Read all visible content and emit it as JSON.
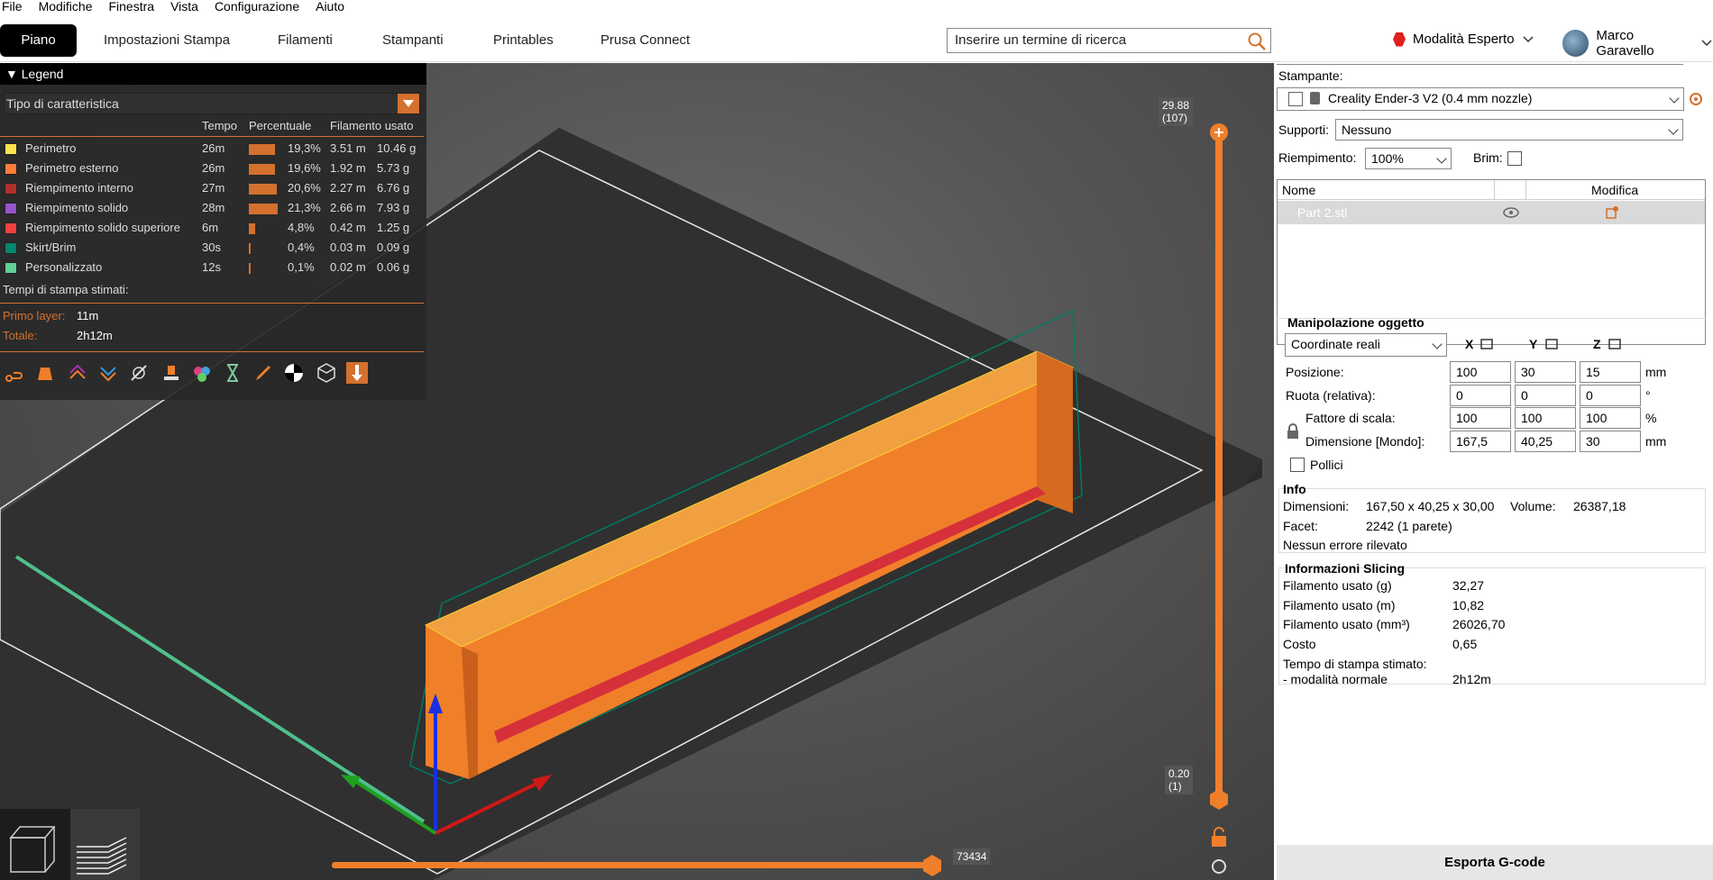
{
  "menu": [
    "File",
    "Modifiche",
    "Finestra",
    "Vista",
    "Configurazione",
    "Aiuto"
  ],
  "tabs": [
    "Piano",
    "Impostazioni Stampa",
    "Filamenti",
    "Stampanti",
    "Printables",
    "Prusa Connect"
  ],
  "search": {
    "placeholder": "Inserire un termine di ricerca"
  },
  "mode_label": "Modalità Esperto",
  "user_name": "Marco Garavello",
  "legend": {
    "title": "Legend",
    "feature_type": "Tipo di caratteristica",
    "col_time": "Tempo",
    "col_pct": "Percentuale",
    "col_filament": "Filamento usato",
    "rows": [
      {
        "name": "Perimetro",
        "time": "26m",
        "pct": "19,3%",
        "len": "3.51 m",
        "weight": "10.46 g",
        "color": "#ffe14d",
        "share": 0.193
      },
      {
        "name": "Perimetro esterno",
        "time": "26m",
        "pct": "19,6%",
        "len": "1.92 m",
        "weight": "5.73 g",
        "color": "#ff7d38",
        "share": 0.196
      },
      {
        "name": "Riempimento interno",
        "time": "27m",
        "pct": "20,6%",
        "len": "2.27 m",
        "weight": "6.76 g",
        "color": "#b03029",
        "share": 0.206
      },
      {
        "name": "Riempimento solido",
        "time": "28m",
        "pct": "21,3%",
        "len": "2.66 m",
        "weight": "7.93 g",
        "color": "#9654cc",
        "share": 0.213
      },
      {
        "name": "Riempimento solido superiore",
        "time": "6m",
        "pct": "4,8%",
        "len": "0.42 m",
        "weight": "1.25 g",
        "color": "#f04040",
        "share": 0.048
      },
      {
        "name": "Skirt/Brim",
        "time": "30s",
        "pct": "0,4%",
        "len": "0.03 m",
        "weight": "0.09 g",
        "color": "#00876e",
        "share": 0.004
      },
      {
        "name": "Personalizzato",
        "time": "12s",
        "pct": "0,1%",
        "len": "0.02 m",
        "weight": "0.06 g",
        "color": "#5ed194",
        "share": 0.001
      }
    ],
    "est_label": "Tempi di stampa stimati:",
    "first_layer_label": "Primo layer:",
    "first_layer_value": "11m",
    "total_label": "Totale:",
    "total_value": "2h12m"
  },
  "slider": {
    "top_value": "29.88",
    "top_layer": "(107)",
    "bottom_value": "0.20",
    "bottom_layer": "(1)",
    "horizontal_value": "73434"
  },
  "right": {
    "printer_label": "Stampante:",
    "printer_value": "Creality Ender-3 V2 (0.4 mm nozzle)",
    "supports_label": "Supporti:",
    "supports_value": "Nessuno",
    "infill_label": "Riempimento:",
    "infill_value": "100%",
    "brim_label": "Brim:",
    "objects_col_name": "Nome",
    "objects_col_edit": "Modifica",
    "object_name": "Part 2.stl",
    "manip_title": "Manipolazione oggetto",
    "coord_select": "Coordinate reali",
    "axis_x": "X",
    "axis_y": "Y",
    "axis_z": "Z",
    "position_label": "Posizione:",
    "position": [
      "100",
      "30",
      "15"
    ],
    "position_unit": "mm",
    "rotate_label": "Ruota (relativa):",
    "rotate": [
      "0",
      "0",
      "0"
    ],
    "rotate_unit": "°",
    "scale_label": "Fattore di scala:",
    "scale": [
      "100",
      "100",
      "100"
    ],
    "scale_unit": "%",
    "size_label": "Dimensione [Mondo]:",
    "size": [
      "167,5",
      "40,25",
      "30"
    ],
    "size_unit": "mm",
    "inches_label": "Pollici",
    "info_title": "Info",
    "dim_label": "Dimensioni:",
    "dim_value": "167,50 x 40,25 x 30,00",
    "volume_label": "Volume:",
    "volume_value": "26387,18",
    "facets_label": "Facet:",
    "facets_value": "2242 (1 parete)",
    "no_errors": "Nessun errore rilevato",
    "slicing_title": "Informazioni Slicing",
    "fil_g_label": "Filamento usato (g)",
    "fil_g_value": "32,27",
    "fil_m_label": "Filamento usato (m)",
    "fil_m_value": "10,82",
    "fil_mm3_label": "Filamento usato (mm³)",
    "fil_mm3_value": "26026,70",
    "cost_label": "Costo",
    "cost_value": "0,65",
    "est_time_label": "Tempo di stampa stimato:",
    "normal_mode_label": "- modalità normale",
    "normal_mode_value": "2h12m",
    "export_label": "Esporta G-code"
  }
}
